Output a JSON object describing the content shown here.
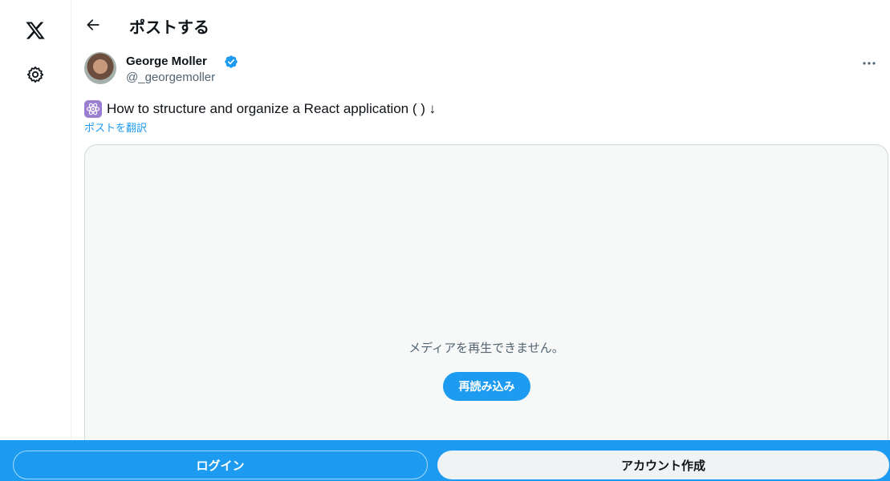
{
  "nav": {
    "logo_icon": "x-logo-icon",
    "settings_icon": "gear-icon"
  },
  "header": {
    "back_icon": "arrow-left-icon",
    "title": "ポストする"
  },
  "post": {
    "author": {
      "name": "George Moller",
      "handle": "@_georgemoller",
      "verified": true
    },
    "text": "How to structure and organize a React application ( ) ↓",
    "emoji_icon": "react-atom-icon",
    "translate_label": "ポストを翻訳",
    "media": {
      "error_message": "メディアを再生できません。",
      "reload_label": "再読み込み"
    }
  },
  "bottom_bar": {
    "login_label": "ログイン",
    "signup_label": "アカウント作成"
  },
  "colors": {
    "accent": "#1d9bf0",
    "text_primary": "#0f1419",
    "text_secondary": "#536471",
    "media_bg": "#f7f9f9"
  }
}
